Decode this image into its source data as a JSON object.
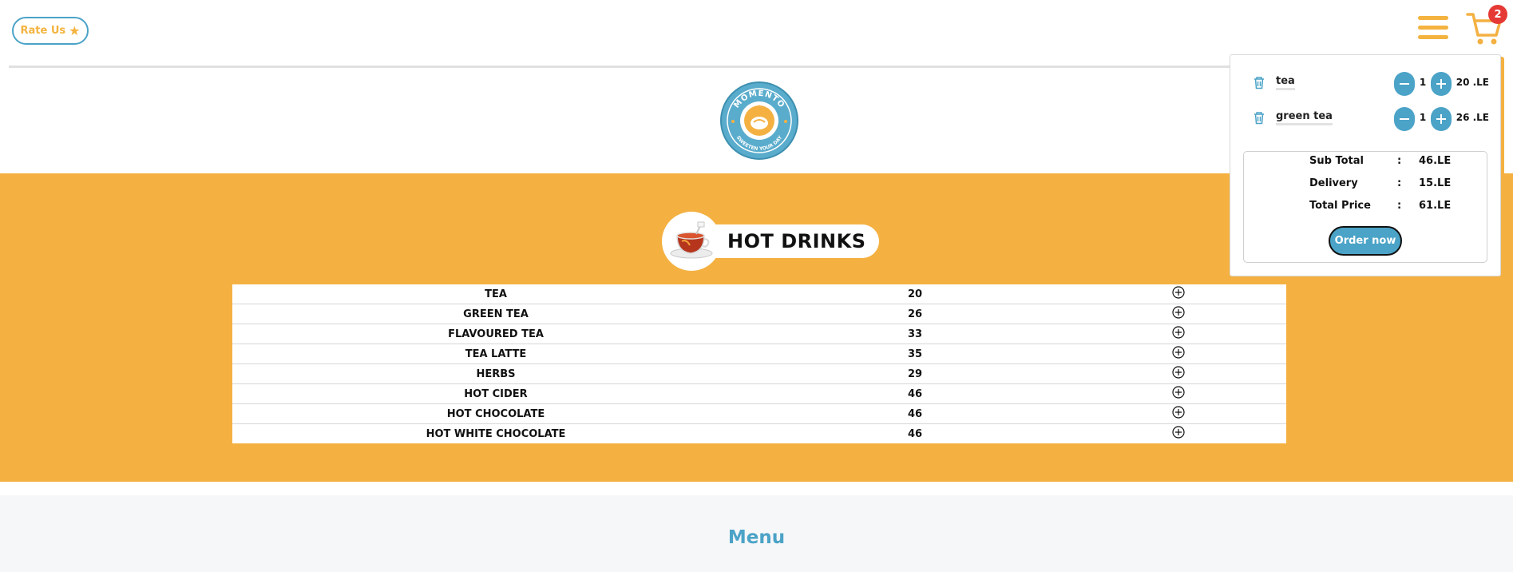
{
  "header": {
    "rate_label": "Rate Us",
    "cart_count": "2"
  },
  "logo": {
    "brand_top": "MOMENTO",
    "brand_bottom": "SWEETEN YOUR DAY"
  },
  "category": {
    "title": "HOT DRINKS",
    "items": [
      {
        "name": "TEA",
        "price": "20"
      },
      {
        "name": "GREEN TEA",
        "price": "26"
      },
      {
        "name": "FLAVOURED TEA",
        "price": "33"
      },
      {
        "name": "TEA LATTE",
        "price": "35"
      },
      {
        "name": "HERBS",
        "price": "29"
      },
      {
        "name": "HOT CIDER",
        "price": "46"
      },
      {
        "name": "HOT CHOCOLATE",
        "price": "46"
      },
      {
        "name": "HOT WHITE CHOCOLATE",
        "price": "46"
      }
    ]
  },
  "cart": {
    "items": [
      {
        "name": "tea",
        "qty": "1",
        "price": "20 .LE"
      },
      {
        "name": "green tea",
        "qty": "1",
        "price": "26 .LE"
      }
    ],
    "summary": {
      "subtotal_label": "Sub Total",
      "subtotal_value": "46.LE",
      "delivery_label": "Delivery",
      "delivery_value": "15.LE",
      "total_label": "Total Price",
      "total_value": "61.LE",
      "colon": ":"
    },
    "order_label": "Order now"
  },
  "footer": {
    "menu_label": "Menu"
  },
  "colors": {
    "accent_orange": "#f4b142",
    "accent_blue": "#4ba3c7",
    "badge_red": "#e53935"
  }
}
